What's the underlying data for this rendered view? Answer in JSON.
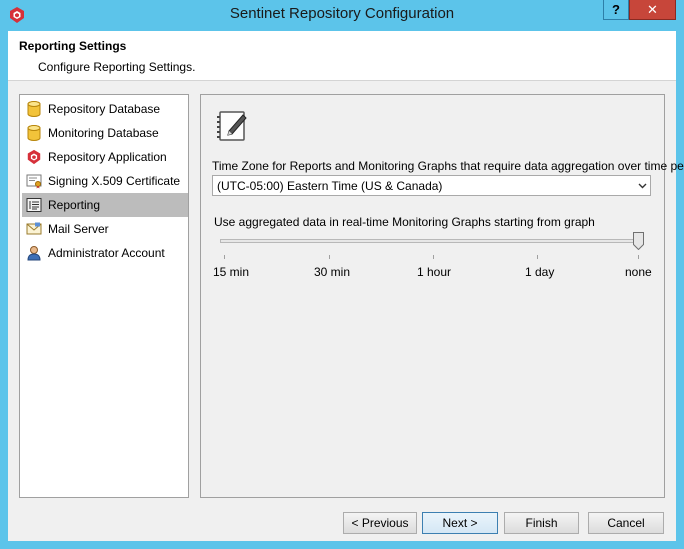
{
  "window": {
    "title": "Sentinet Repository Configuration",
    "help_label": "?",
    "close_label": "✕"
  },
  "header": {
    "title": "Reporting Settings",
    "subtitle": "Configure Reporting Settings."
  },
  "nav": {
    "items": [
      {
        "label": "Repository Database",
        "icon": "database-icon"
      },
      {
        "label": "Monitoring Database",
        "icon": "database-icon"
      },
      {
        "label": "Repository Application",
        "icon": "sentinet-shield-icon"
      },
      {
        "label": "Signing X.509 Certificate",
        "icon": "certificate-icon"
      },
      {
        "label": "Reporting",
        "icon": "report-icon",
        "selected": true
      },
      {
        "label": "Mail Server",
        "icon": "mail-icon"
      },
      {
        "label": "Administrator Account",
        "icon": "user-icon"
      }
    ]
  },
  "reporting": {
    "timezone_label": "Time Zone for Reports and Monitoring Graphs that require data aggregation over time periods",
    "timezone_value": "(UTC-05:00) Eastern Time (US & Canada)",
    "aggregation_label": "Use aggregated data in real-time Monitoring Graphs starting from graph",
    "slider": {
      "options": [
        "15 min",
        "30 min",
        "1 hour",
        "1 day",
        "none"
      ],
      "selected": "none"
    }
  },
  "buttons": {
    "previous": "< Previous",
    "next": "Next >",
    "finish": "Finish",
    "cancel": "Cancel"
  },
  "colors": {
    "titlebar": "#5cc4ea",
    "close": "#c7463a",
    "selected_item": "#bcbcbc",
    "brand_red": "#d6303a"
  }
}
